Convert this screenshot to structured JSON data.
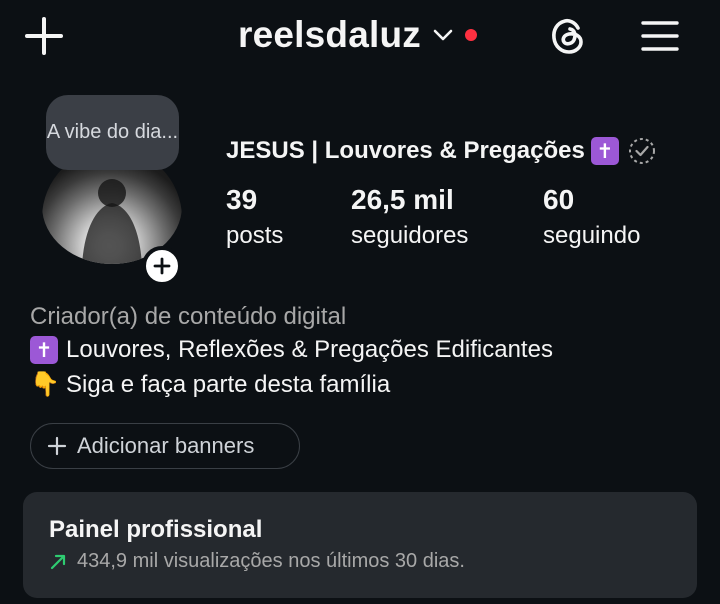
{
  "header": {
    "username": "reelsdaluz",
    "icons": {
      "create": "plus-icon",
      "account_switch": "chevron-down-icon",
      "threads": "threads-icon",
      "menu": "hamburger-menu-icon"
    },
    "notification_dot_color": "#ff3040"
  },
  "profile": {
    "note": "A vibe do dia...",
    "display_name": "JESUS | Louvores & Pregações",
    "name_emoji": "✝",
    "badge_icon": "verified-dashed-badge-icon",
    "stats": [
      {
        "value": "39",
        "label": "posts"
      },
      {
        "value": "26,5 mil",
        "label": "seguidores"
      },
      {
        "value": "60",
        "label": "seguindo"
      }
    ],
    "category": "Criador(a) de conteúdo digital",
    "bio": [
      {
        "emoji": "✝",
        "text": "Louvores, Reflexões & Pregações Edificantes"
      },
      {
        "emoji": "👇",
        "text": "Siga e faça parte desta família"
      }
    ]
  },
  "actions": {
    "add_banners_label": "Adicionar banners"
  },
  "professional_panel": {
    "title": "Painel profissional",
    "stat_text": "434,9 mil visualizações nos últimos 30 dias.",
    "trend_icon": "trend-up-arrow-icon",
    "trend_color": "#2ecc71"
  },
  "colors": {
    "background": "#0c1014",
    "panel": "#25292e",
    "emoji_tile": "#9c58d6"
  }
}
